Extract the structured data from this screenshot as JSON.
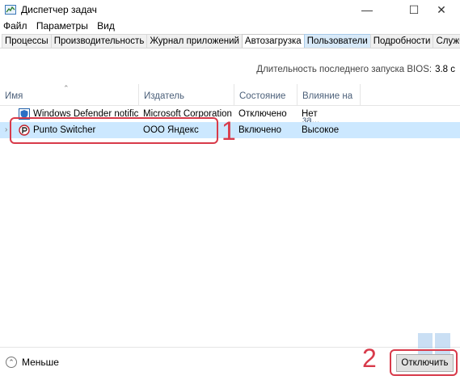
{
  "window": {
    "title": "Диспетчер задач",
    "controls": {
      "minimize": "—",
      "maximize": "☐",
      "close": "✕"
    }
  },
  "menu": [
    "Файл",
    "Параметры",
    "Вид"
  ],
  "tabs": [
    {
      "label": "Процессы",
      "active": false
    },
    {
      "label": "Производительность",
      "active": false
    },
    {
      "label": "Журнал приложений",
      "active": false
    },
    {
      "label": "Автозагрузка",
      "active": true
    },
    {
      "label": "Пользователи",
      "active": false
    },
    {
      "label": "Подробности",
      "active": false
    },
    {
      "label": "Службы",
      "active": false
    }
  ],
  "bios": {
    "label": "Длительность последнего запуска BIOS:",
    "value": "3.8 с"
  },
  "table": {
    "columns": [
      "Имя",
      "Издатель",
      "Состояние",
      "Влияние на за..."
    ],
    "rows": [
      {
        "name": "Windows Defender notificati...",
        "publisher": "Microsoft Corporation",
        "status": "Отключено",
        "impact": "Нет",
        "icon": "defender-icon",
        "selected": false
      },
      {
        "name": "Punto Switcher",
        "publisher": "ООО Яндекс",
        "status": "Включено",
        "impact": "Высокое",
        "icon": "punto-switcher-icon",
        "selected": true
      }
    ]
  },
  "annotations": {
    "one": "1",
    "two": "2"
  },
  "footer": {
    "less_label": "Меньше",
    "disable_label": "Отключить"
  },
  "colors": {
    "selection": "#cce8ff",
    "annotation": "#d83a4a",
    "header_text": "#4c607a"
  }
}
